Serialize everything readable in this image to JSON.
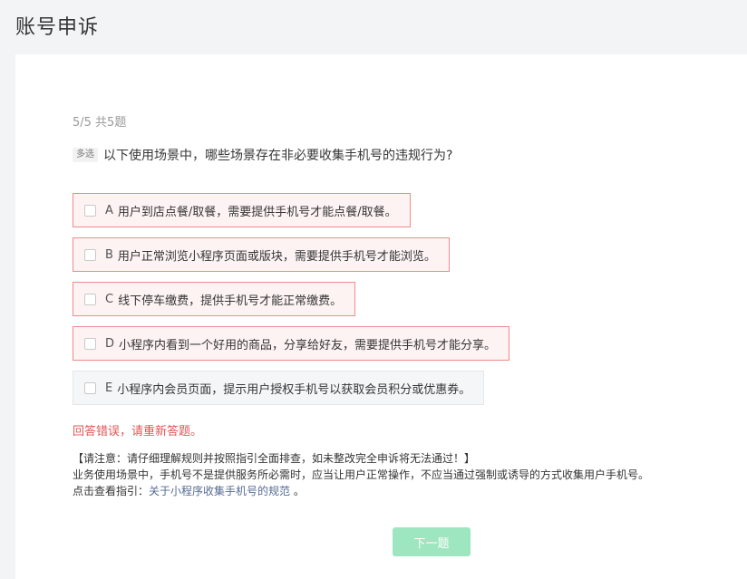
{
  "header": {
    "title": "账号申诉"
  },
  "quiz": {
    "progress": "5/5 共5题",
    "question_tag": "多选",
    "question_text": "以下使用场景中，哪些场景存在非必要收集手机号的违规行为?",
    "options": [
      {
        "letter": "A",
        "text": "用户到店点餐/取餐，需要提供手机号才能点餐/取餐。",
        "state": "wrong"
      },
      {
        "letter": "B",
        "text": "用户正常浏览小程序页面或版块，需要提供手机号才能浏览。",
        "state": "wrong"
      },
      {
        "letter": "C",
        "text": "线下停车缴费，提供手机号才能正常缴费。",
        "state": "wrong"
      },
      {
        "letter": "D",
        "text": "小程序内看到一个好用的商品，分享给好友，需要提供手机号才能分享。",
        "state": "wrong"
      },
      {
        "letter": "E",
        "text": "小程序内会员页面，提示用户授权手机号以获取会员积分或优惠券。",
        "state": "neutral"
      }
    ],
    "error_message": "回答错误，请重新答题。",
    "notice": {
      "line1": "【请注意：请仔细理解规则并按照指引全面排查，如未整改完全申诉将无法通过！】",
      "line2": "业务使用场景中，手机号不是提供服务所必需时，应当让用户正常操作，不应当通过强制或诱导的方式收集用户手机号。",
      "line3_prefix": "点击查看指引：",
      "link_text": "关于小程序收集手机号的规范",
      "line3_suffix": " 。"
    },
    "next_label": "下一题"
  },
  "colors": {
    "wrong_border": "#f08b8b",
    "wrong_bg": "#fdf3f3",
    "error_text": "#e05656",
    "link": "#576b95",
    "button_disabled": "#9ee6bf"
  }
}
